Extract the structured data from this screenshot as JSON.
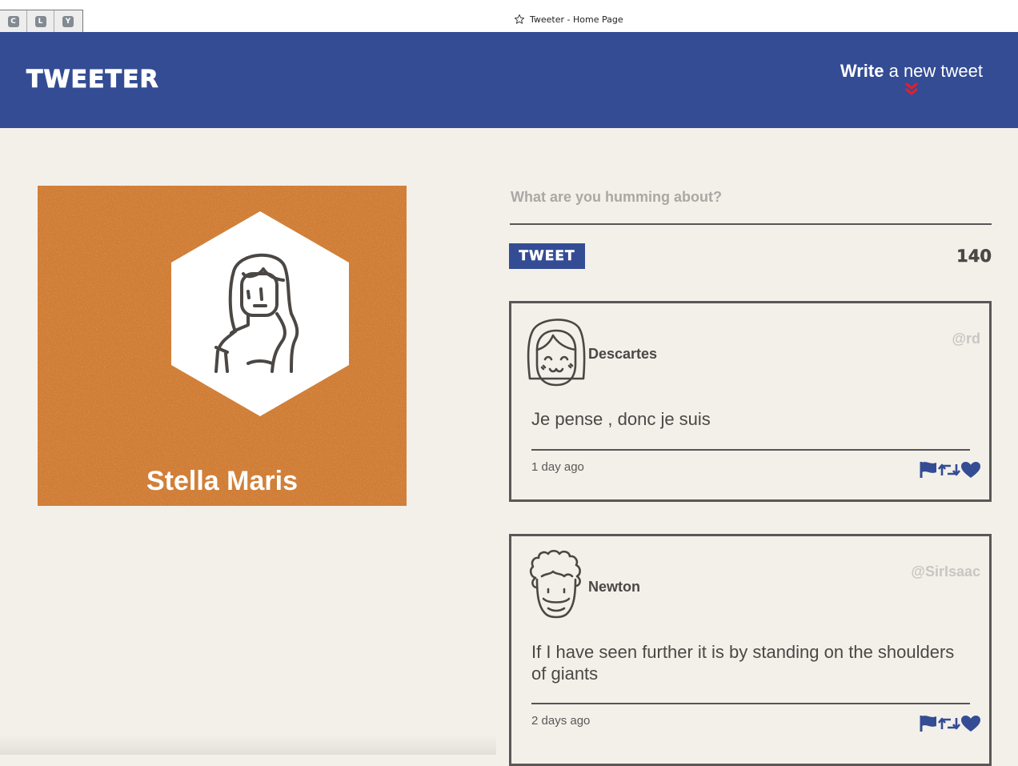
{
  "browser": {
    "tab_buttons": [
      "C",
      "L",
      "Y"
    ],
    "title": "Tweeter - Home Page",
    "title_icon": "star-icon"
  },
  "header": {
    "logo": "TWEETER",
    "compose_toggle": {
      "bold": "Write",
      "rest": " a new tweet",
      "icon": "double-chevron-down-icon",
      "icon_color": "#e3202b"
    }
  },
  "profile": {
    "name": "Stella Maris",
    "background_color": "#d07d35",
    "avatar_icon": "woman-long-hair-icon"
  },
  "compose": {
    "placeholder": "What are you humming about?",
    "button_label": "Tweet",
    "counter": "140"
  },
  "tweets": [
    {
      "name": "Descartes",
      "handle": "@rd",
      "text": "Je pense , donc je suis",
      "time": "1 day ago",
      "avatar_icon": "bob-haircut-face-icon"
    },
    {
      "name": "Newton",
      "handle": "@SirIsaac",
      "text": "If I have seen further it is by standing on the shoulders of giants",
      "time": "2 days ago",
      "avatar_icon": "curly-hair-face-icon"
    }
  ],
  "actions": [
    "flag-icon",
    "retweet-icon",
    "heart-icon"
  ],
  "colors": {
    "brand": "#344c94",
    "background": "#f3f0ea",
    "text": "#4a4845"
  }
}
